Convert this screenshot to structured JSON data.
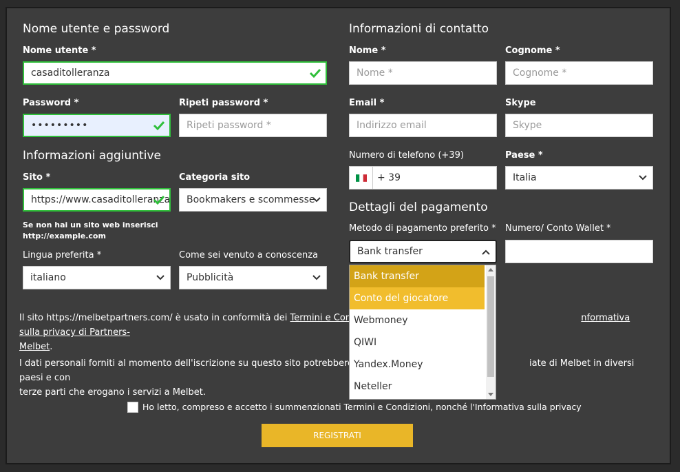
{
  "left": {
    "heading": "Nome utente e password",
    "username_label": "Nome utente *",
    "username_value": "casaditolleranza",
    "password_label": "Password *",
    "password_value": "•••••••••",
    "repeat_label": "Ripeti password *",
    "repeat_placeholder": "Ripeti password *",
    "extra_heading": "Informazioni aggiuntive",
    "site_label": "Sito *",
    "site_value": "https://www.casaditolleranza",
    "category_label": "Categoria sito",
    "category_value": "Bookmakers e scommesse",
    "site_note_1": "Se non hai un sito web inserisci",
    "site_note_2": "http://example.com",
    "language_label": "Lingua preferita *",
    "language_value": "italiano",
    "source_label": "Come sei venuto a conoscenza",
    "source_value": "Pubblicità"
  },
  "right": {
    "heading": "Informazioni di contatto",
    "name_label": "Nome *",
    "name_placeholder": "Nome *",
    "surname_label": "Cognome *",
    "surname_placeholder": "Cognome *",
    "email_label": "Email *",
    "email_placeholder": "Indirizzo email",
    "skype_label": "Skype",
    "skype_placeholder": "Skype",
    "phone_label": "Numero di telefono  (+39)",
    "phone_prefix": "+  39",
    "country_label": "Paese *",
    "country_value": "Italia",
    "payment_heading": "Dettagli del pagamento",
    "method_label": "Metodo di pagamento preferito *",
    "method_value": "Bank transfer",
    "wallet_label": "Numero/ Conto Wallet *",
    "method_options": [
      "Bank transfer",
      "Conto del giocatore",
      "Webmoney",
      "QIWI",
      "Yandex.Money",
      "Neteller"
    ]
  },
  "terms": {
    "p1_start": "Il sito https://melbetpartners.com/ è usato in conformità dei ",
    "p1_link1": "Termini e Cond",
    "p1_link2": "nformativa sulla privacy di Partners-",
    "p1_link3": "Melbet",
    "p1_end": ".",
    "p2_a": "I dati personali forniti al momento dell'iscrizione su questo sito potrebbero",
    "p2_b": "iate di Melbet in diversi paesi e con",
    "p2_c": "terze parti che erogano i servizi a Melbet.",
    "accept_text": "Ho letto, compreso e accetto i summenzionati Termini e Condizioni, nonché l'Informativa sulla privacy",
    "register_label": "REGISTRATI"
  },
  "colors": {
    "panel": "#3d3d3d",
    "accent": "#e9b628",
    "valid": "#2fbf3a",
    "option_selected": "#d3a317",
    "option_hover": "#f1bd2d"
  }
}
